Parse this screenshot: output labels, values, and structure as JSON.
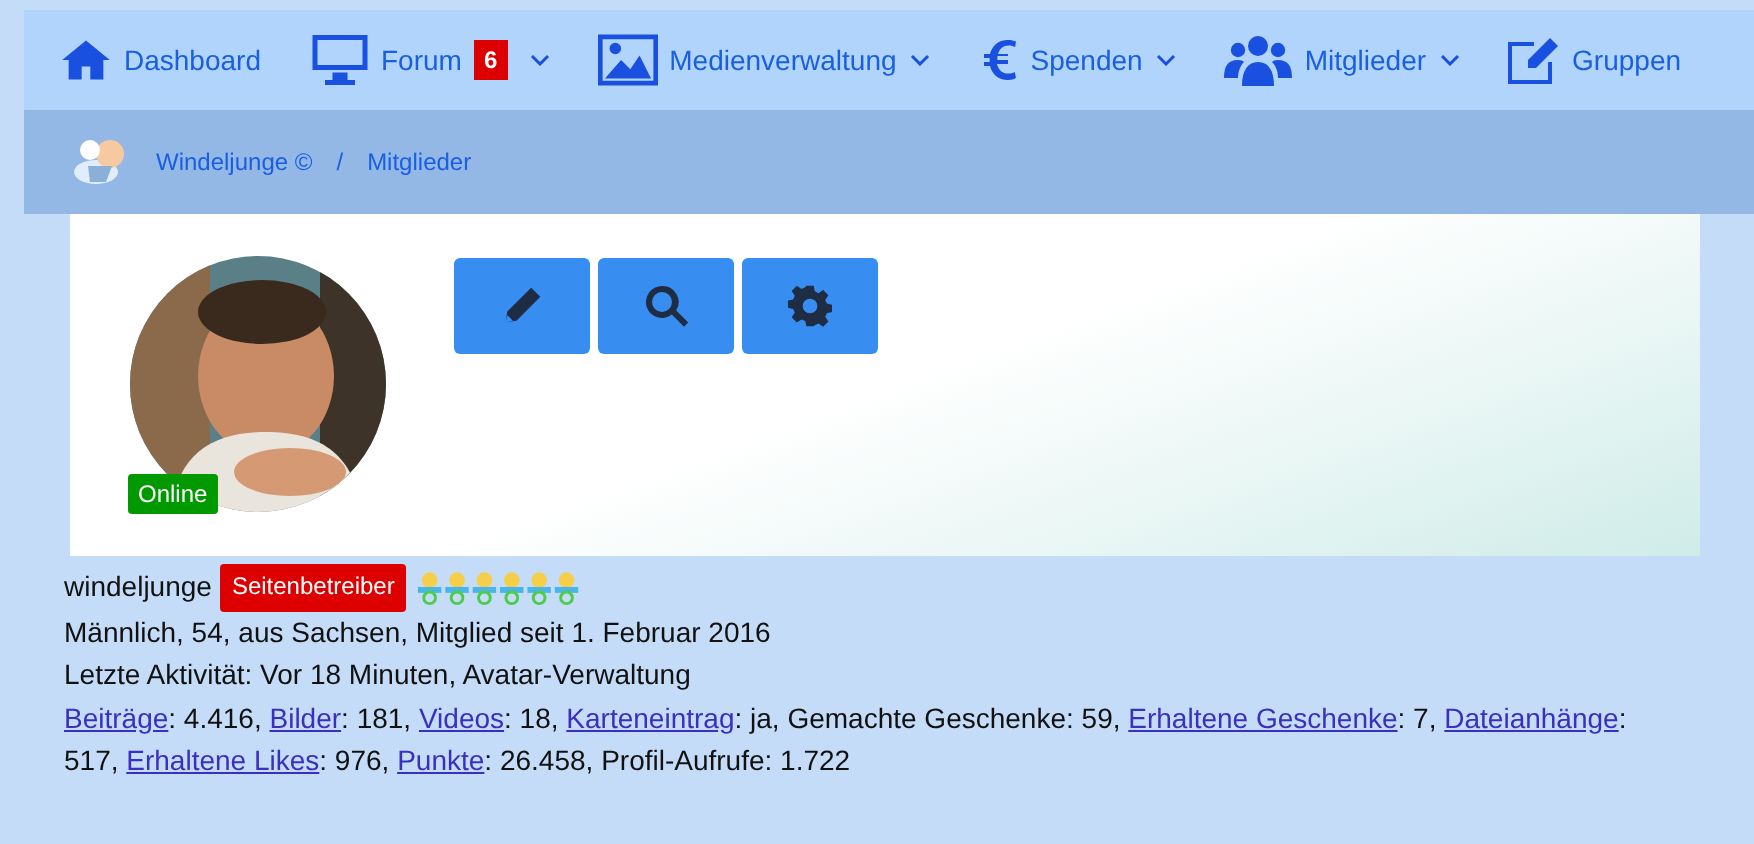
{
  "nav": [
    {
      "label": "Dashboard",
      "dropdown": false
    },
    {
      "label": "Forum",
      "badge": "6",
      "dropdown": true
    },
    {
      "label": "Medienverwaltung",
      "dropdown": true
    },
    {
      "label": "Spenden",
      "dropdown": true
    },
    {
      "label": "Mitglieder",
      "dropdown": true
    },
    {
      "label": "Gruppen",
      "dropdown": false
    }
  ],
  "breadcrumb": [
    {
      "label": "Windeljunge ©"
    },
    {
      "separator": "/",
      "label": "Mitglieder"
    }
  ],
  "profile": {
    "status": "Online",
    "username": "windeljunge",
    "role": "Seitenbetreiber",
    "info": [
      "Männlich, 54, aus Sachsen, Mitglied seit 1. Februar 2016",
      "Letzte Aktivität: Vor 18 Minuten, Avatar-Verwaltung"
    ],
    "stats": [
      {
        "label": "Beiträge",
        "rest": ": 4.416,",
        "link": true
      },
      {
        "label": "Bilder",
        "rest": ": 181,",
        "link": true
      },
      {
        "label": "Videos",
        "rest": ": 18,",
        "link": true
      },
      {
        "label": "Karteneintrag",
        "rest": ": ja,",
        "link": true
      },
      {
        "label": "Gemachte Geschenke",
        "rest": ": 59,",
        "link": false
      },
      {
        "label": "Erhaltene Geschenke",
        "rest": ": 7,",
        "link": true
      },
      {
        "label": "Dateianhänge",
        "rest": ":",
        "link": true
      },
      {
        "label": "517,",
        "link": false
      },
      {
        "label": "Erhaltene Likes",
        "rest": ": 976,",
        "link": true
      },
      {
        "label": "Punkte",
        "rest": ": 26.458,",
        "link": true
      },
      {
        "label": "Profil-Aufrufe",
        "rest": ": 1.722",
        "link": false
      }
    ]
  }
}
